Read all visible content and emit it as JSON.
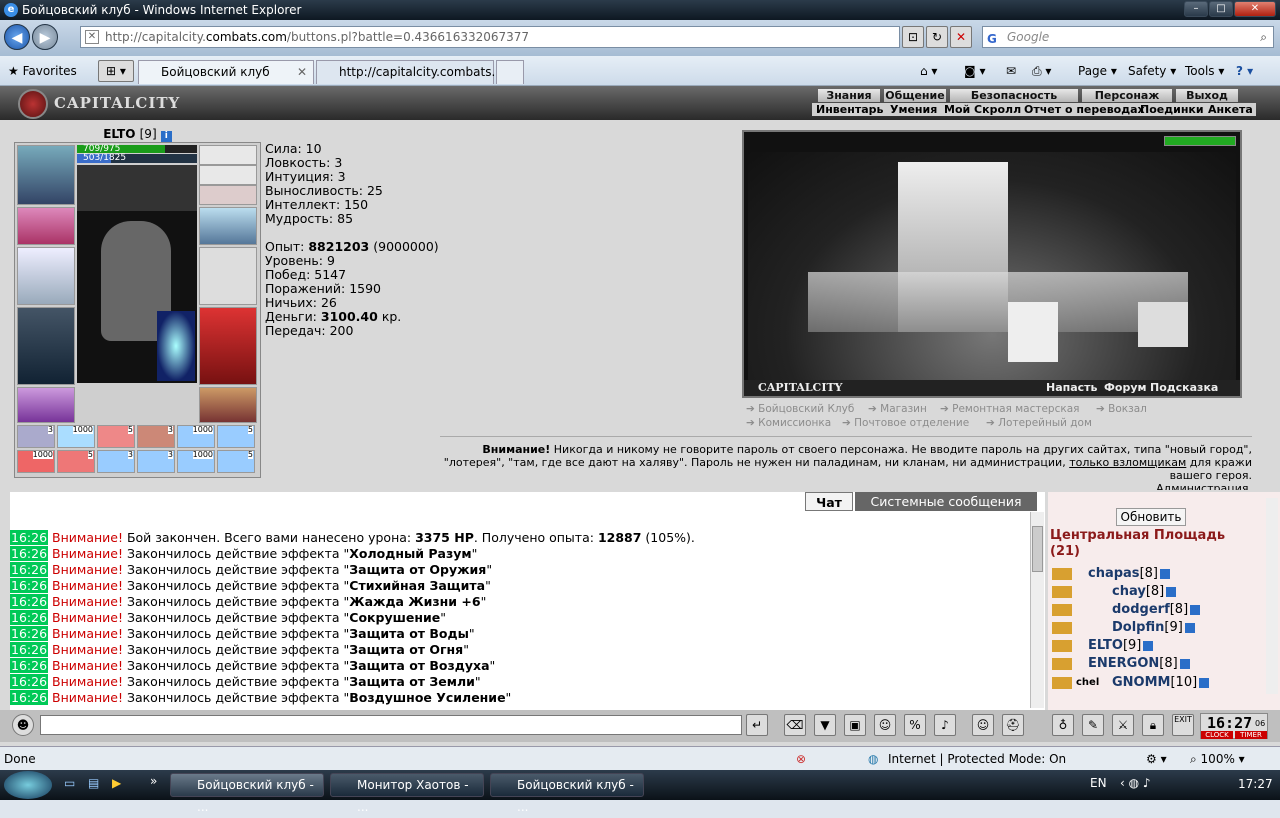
{
  "window": {
    "title": "Бойцовский клуб - Windows Internet Explorer"
  },
  "browser": {
    "url_prefix": "http://capitalcity.",
    "url_domain": "combats.com",
    "url_suffix": "/buttons.pl?battle=0.436616332067377",
    "search_placeholder": "Google",
    "favorites": "Favorites",
    "tab1": "Бойцовский клуб",
    "tab2": "http://capitalcity.combats....",
    "cmd_page": "Page",
    "cmd_safety": "Safety",
    "cmd_tools": "Tools"
  },
  "game": {
    "logo": "CAPITALCITY",
    "menu_top": [
      "Знания",
      "Общение",
      "Безопасность",
      "Персонаж",
      "Выход"
    ],
    "menu_sub": [
      "Инвентарь",
      "Умения",
      "Мой Скролл",
      "Отчет о переводах",
      "Поединки",
      "Анкета"
    ],
    "char_name": "ELTO",
    "char_level": "[9]",
    "hp": "709/975",
    "mana": "503/1825",
    "stats": [
      "Сила: 10",
      "Ловкость: 3",
      "Интуиция: 3",
      "Выносливость: 25",
      "Интеллект: 150",
      "Мудрость: 85"
    ],
    "exp_label": "Опыт:",
    "exp_value": "8821203",
    "exp_next": "(9000000)",
    "stats2": [
      "Уровень: 9",
      "Побед: 5147",
      "Поражений: 1590",
      "Ничьих: 26"
    ],
    "money_label": "Деньги:",
    "money_value": "3100.40",
    "money_unit": "кр.",
    "transfers": "Передач: 200",
    "scene_title": "CAPITALCITY",
    "scene_links": [
      "Напасть",
      "Форум",
      "Подсказка"
    ],
    "locations_row1": [
      "Бойцовский Клуб",
      "Магазин",
      "Ремонтная мастерская",
      "Вокзал"
    ],
    "locations_row2": [
      "Комиссионка",
      "Почтовое отделение",
      "Лотерейный дом"
    ],
    "warning_bold": "Внимание!",
    "warning_text1": " Никогда и никому не говорите пароль от своего персонажа. Не вводите пароль на других сайтах, типа \"новый город\",",
    "warning_text2": "\"лотерея\", \"там, где все дают на халяву\". Пароль не нужен ни паладинам, ни кланам, ни администрации,",
    "warning_link": "только взломщикам",
    "warning_text3": " для кражи",
    "warning_text4": "вашего героя.",
    "warning_text5": "Администрация.",
    "chat_tab": "Чат",
    "system_tab": "Системные сообщения",
    "chat_lines": [
      {
        "time": "16:26",
        "warn": "Внимание!",
        "text": " Бой закончен. Всего вами нанесено урона: ",
        "bold": "3375 HP",
        "tail": ". Получено опыта: ",
        "bold2": "12887",
        "tail2": " (105%)."
      },
      {
        "time": "16:26",
        "warn": "Внимание!",
        "text": " Закончилось действие эффекта \"",
        "bold": "Холодный Разум",
        "tail": "\"",
        "bold2": "",
        "tail2": ""
      },
      {
        "time": "16:26",
        "warn": "Внимание!",
        "text": " Закончилось действие эффекта \"",
        "bold": "Защита от Оружия",
        "tail": "\"",
        "bold2": "",
        "tail2": ""
      },
      {
        "time": "16:26",
        "warn": "Внимание!",
        "text": " Закончилось действие эффекта \"",
        "bold": "Стихийная Защита",
        "tail": "\"",
        "bold2": "",
        "tail2": ""
      },
      {
        "time": "16:26",
        "warn": "Внимание!",
        "text": " Закончилось действие эффекта \"",
        "bold": "Жажда Жизни +6",
        "tail": "\"",
        "bold2": "",
        "tail2": ""
      },
      {
        "time": "16:26",
        "warn": "Внимание!",
        "text": " Закончилось действие эффекта \"",
        "bold": "Сокрушение",
        "tail": "\"",
        "bold2": "",
        "tail2": ""
      },
      {
        "time": "16:26",
        "warn": "Внимание!",
        "text": " Закончилось действие эффекта \"",
        "bold": "Защита от Воды",
        "tail": "\"",
        "bold2": "",
        "tail2": ""
      },
      {
        "time": "16:26",
        "warn": "Внимание!",
        "text": " Закончилось действие эффекта \"",
        "bold": "Защита от Огня",
        "tail": "\"",
        "bold2": "",
        "tail2": ""
      },
      {
        "time": "16:26",
        "warn": "Внимание!",
        "text": " Закончилось действие эффекта \"",
        "bold": "Защита от Воздуха",
        "tail": "\"",
        "bold2": "",
        "tail2": ""
      },
      {
        "time": "16:26",
        "warn": "Внимание!",
        "text": " Закончилось действие эффекта \"",
        "bold": "Защита от Земли",
        "tail": "\"",
        "bold2": "",
        "tail2": ""
      },
      {
        "time": "16:26",
        "warn": "Внимание!",
        "text": " Закончилось действие эффекта \"",
        "bold": "Воздушное Усиление",
        "tail": "\"",
        "bold2": "",
        "tail2": ""
      }
    ],
    "refresh_btn": "Обновить",
    "room_name": "Центральная Площадь",
    "room_count": "(21)",
    "users": [
      {
        "name": "chapas",
        "lvl": "[8]"
      },
      {
        "name": "chay",
        "lvl": "[8]"
      },
      {
        "name": "dodgerf",
        "lvl": "[8]"
      },
      {
        "name": "Dolpfin",
        "lvl": "[9]"
      },
      {
        "name": "ELTO",
        "lvl": "[9]"
      },
      {
        "name": "ENERGON",
        "lvl": "[8]"
      },
      {
        "name": "GNOMM",
        "lvl": "[10]"
      }
    ],
    "clan_tag": "chel",
    "clock": "16:27",
    "clock_sec": "06",
    "clock_label": "CLOCK",
    "timer_label": "TIMER",
    "exit_label": "EXIT",
    "item_counts": [
      "3",
      "1000",
      "5",
      "3",
      "1000",
      "5",
      "1000",
      "5",
      "3",
      "3",
      "1000",
      "5",
      "1000",
      "5",
      "1000",
      "5"
    ]
  },
  "statusbar": {
    "left": "Done",
    "zone": "Internet | Protected Mode: On",
    "zoom": "100%"
  },
  "taskbar": {
    "tasks": [
      "Бойцовский клуб - ...",
      "Монитор Хаотов - ...",
      "Бойцовский клуб - ..."
    ],
    "lang": "EN",
    "time": "17:27"
  }
}
